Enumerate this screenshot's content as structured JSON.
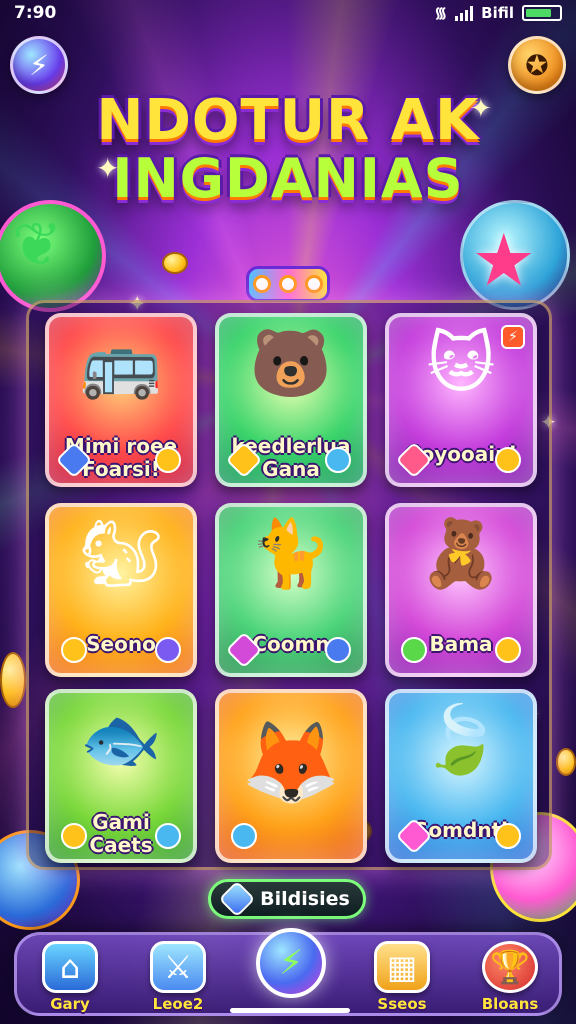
{
  "status_bar": {
    "time": "7:90",
    "carrier": "Bifil"
  },
  "header": {
    "title_line1": "NDOTUR AK",
    "title_line2": "INGDANIAS"
  },
  "tiles": [
    {
      "label": "Mimi roee\nFoarsi!"
    },
    {
      "label": "keedlerlua\nGana"
    },
    {
      "label": "Coyooaini"
    },
    {
      "label": "Seono"
    },
    {
      "label": "Coomn"
    },
    {
      "label": "Bama"
    },
    {
      "label": "Gami\nCaets"
    },
    {
      "label": ""
    },
    {
      "label": "Somdntl"
    }
  ],
  "action_button": {
    "label": "Bildisies"
  },
  "nav": {
    "items": [
      {
        "label": "Gary"
      },
      {
        "label": "Leoe2"
      },
      {
        "label": ""
      },
      {
        "label": "Sseos"
      },
      {
        "label": "Bloans"
      }
    ]
  },
  "icons": {
    "top_left": "lightning-icon",
    "top_right": "coin-icon",
    "nav_home": "home-icon",
    "nav_sword": "sword-icon",
    "nav_center": "lightning-orb-icon",
    "nav_basket": "basket-icon",
    "nav_trophy": "trophy-icon"
  }
}
